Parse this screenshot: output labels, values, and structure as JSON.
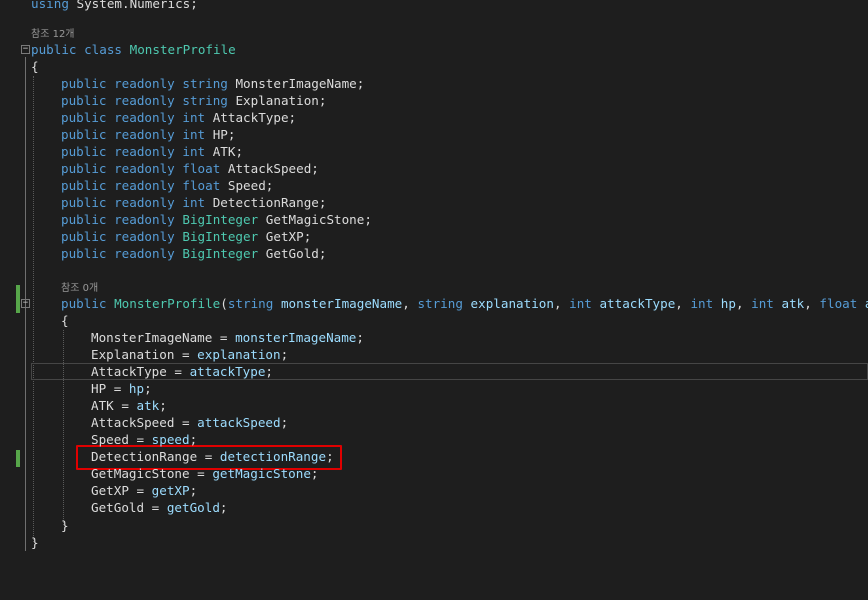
{
  "editor": {
    "top_line": "using System.Numerics;",
    "lens_class": "참조 12개",
    "lens_ctor": "참조 0개",
    "class_decl": {
      "kw1": "public",
      "kw2": "class",
      "name": "MonsterProfile"
    },
    "open_brace": "{",
    "close_brace": "}",
    "fields": [
      {
        "type": "string",
        "name": "MonsterImageName",
        "kind": "kw"
      },
      {
        "type": "string",
        "name": "Explanation",
        "kind": "kw"
      },
      {
        "type": "int",
        "name": "AttackType",
        "kind": "kw"
      },
      {
        "type": "int",
        "name": "HP",
        "kind": "kw"
      },
      {
        "type": "int",
        "name": "ATK",
        "kind": "kw"
      },
      {
        "type": "float",
        "name": "AttackSpeed",
        "kind": "kw"
      },
      {
        "type": "float",
        "name": "Speed",
        "kind": "kw"
      },
      {
        "type": "int",
        "name": "DetectionRange",
        "kind": "kw"
      },
      {
        "type": "BigInteger",
        "name": "GetMagicStone",
        "kind": "cls"
      },
      {
        "type": "BigInteger",
        "name": "GetXP",
        "kind": "cls"
      },
      {
        "type": "BigInteger",
        "name": "GetGold",
        "kind": "cls"
      }
    ],
    "field_mods": {
      "public": "public",
      "readonly": "readonly"
    },
    "ctor": {
      "public": "public",
      "name": "MonsterProfile",
      "params": [
        {
          "type": "string",
          "name": "monsterImageName"
        },
        {
          "type": "string",
          "name": "explanation"
        },
        {
          "type": "int",
          "name": "attackType"
        },
        {
          "type": "int",
          "name": "hp"
        },
        {
          "type": "int",
          "name": "atk"
        },
        {
          "type": "float",
          "name": "a"
        }
      ]
    },
    "assignments": [
      {
        "left": "MonsterImageName",
        "right": "monsterImageName"
      },
      {
        "left": "Explanation",
        "right": "explanation"
      },
      {
        "left": "AttackType",
        "right": "attackType"
      },
      {
        "left": "HP",
        "right": "hp"
      },
      {
        "left": "ATK",
        "right": "atk"
      },
      {
        "left": "AttackSpeed",
        "right": "attackSpeed"
      },
      {
        "left": "Speed",
        "right": "speed"
      },
      {
        "left": "DetectionRange",
        "right": "detectionRange"
      },
      {
        "left": "GetMagicStone",
        "right": "getMagicStone"
      },
      {
        "left": "GetXP",
        "right": "getXP"
      },
      {
        "left": "GetGold",
        "right": "getGold"
      }
    ],
    "colors": {
      "background": "#1e1e1e",
      "keyword": "#569cd6",
      "type": "#4ec9b0",
      "identifier": "#dcdcdc",
      "parameter": "#9cdcfe",
      "highlight": "#e00000",
      "change_marker": "#57a64a"
    }
  }
}
